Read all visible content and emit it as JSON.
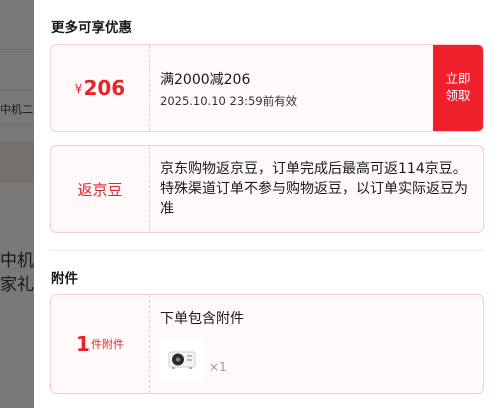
{
  "background_page": {
    "text_a": "中机二",
    "text_b": "中机二",
    "text_c": "家礼"
  },
  "panel": {
    "section_more_offers": "更多可享优惠",
    "coupon": {
      "currency": "¥",
      "amount": "206",
      "title": "满2000减206",
      "expiry": "2025.10.10 23:59前有效",
      "claim_label": "立即领取"
    },
    "beans": {
      "label": "返京豆",
      "description": "京东购物返京豆，订单完成后最高可返114京豆。特殊渠道订单不参与购物返豆，以订单实际返豆为准"
    },
    "section_attachments": "附件",
    "attachment": {
      "count": "1",
      "unit": "件附件",
      "description": "下单包含附件",
      "quantity": "×1",
      "thumbnail_icon": "air-conditioner-outdoor-unit-icon"
    }
  },
  "colors": {
    "accent": "#e3252b",
    "claim_button": "#f01f2c",
    "card_border": "#f6cfd2",
    "card_bg": "#fff9f9"
  }
}
